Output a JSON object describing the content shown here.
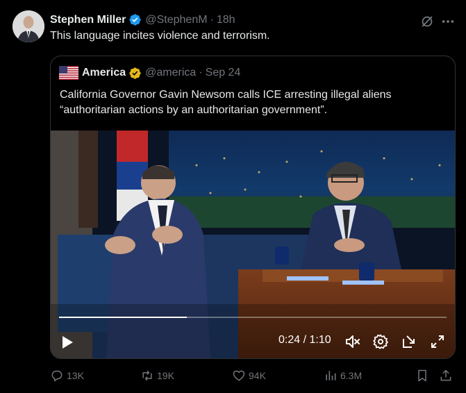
{
  "tweet": {
    "author_name": "Stephen Miller",
    "author_handle": "@StephenM",
    "separator": "·",
    "time": "18h",
    "text": "This language incites violence and terrorism."
  },
  "quote": {
    "author_name": "America",
    "author_handle": "@america",
    "separator": "·",
    "date": "Sep 24",
    "text": "California Governor Gavin Newsom calls ICE arresting illegal aliens “authoritarian actions by an authoritarian government”."
  },
  "video": {
    "timecode": "0:24 / 1:10",
    "progress": 0.33
  },
  "actions": {
    "replies": "13K",
    "reposts": "19K",
    "likes": "94K",
    "views": "6.3M"
  },
  "colors": {
    "background": "#000000",
    "text": "#e7e9ea",
    "muted": "#71767b",
    "verified_blue": "#1d9bf0",
    "verified_gold": "#e2b719",
    "border": "#2f3336"
  },
  "icons": [
    "verified-badge-icon",
    "grok-icon",
    "more-icon",
    "flag-icon",
    "gold-badge-icon",
    "play-icon",
    "mute-icon",
    "settings-gear-icon",
    "pip-icon",
    "fullscreen-icon",
    "reply-icon",
    "repost-icon",
    "like-icon",
    "views-icon",
    "bookmark-icon",
    "share-icon"
  ]
}
